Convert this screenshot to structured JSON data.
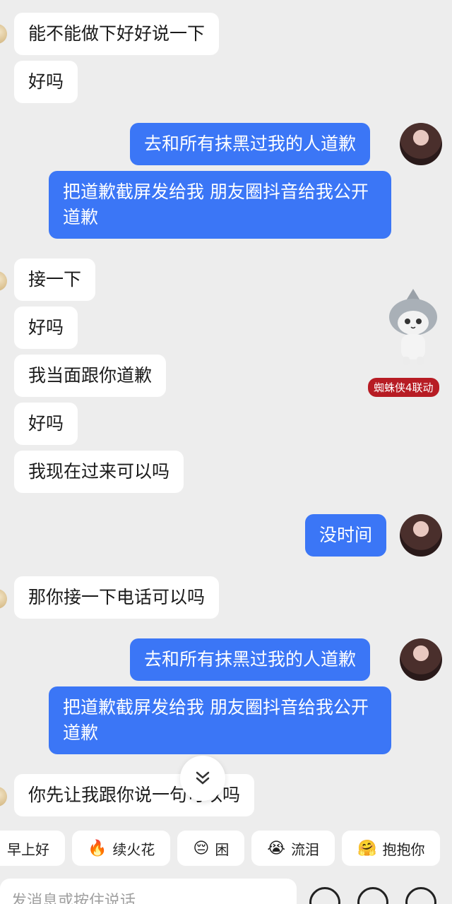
{
  "messages": [
    {
      "side": "left",
      "text": "能不能做下好好说一下"
    },
    {
      "side": "left",
      "text": "好吗"
    },
    {
      "side": "right",
      "text": "去和所有抹黑过我的人道歉"
    },
    {
      "side": "right",
      "text": "把道歉截屏发给我 朋友圈抖音给我公开道歉"
    },
    {
      "side": "left",
      "text": "接一下"
    },
    {
      "side": "left",
      "text": "好吗"
    },
    {
      "side": "left",
      "text": "我当面跟你道歉"
    },
    {
      "side": "left",
      "text": "好吗"
    },
    {
      "side": "left",
      "text": "我现在过来可以吗"
    },
    {
      "side": "right",
      "text": "没时间"
    },
    {
      "side": "left",
      "text": "那你接一下电话可以吗"
    },
    {
      "side": "right",
      "text": "去和所有抹黑过我的人道歉"
    },
    {
      "side": "right",
      "text": "把道歉截屏发给我 朋友圈抖音给我公开道歉"
    },
    {
      "side": "left",
      "text": "你先让我跟你说一句可以吗"
    }
  ],
  "sticker": {
    "badge": "蜘蛛侠4联动",
    "icon": "shark-hat-cat-sticker"
  },
  "scroll_button": {
    "icon": "double-chevron-down-icon"
  },
  "quick_replies": [
    {
      "emoji": "",
      "label": "早上好"
    },
    {
      "emoji": "🔥",
      "label": "续火花"
    },
    {
      "emoji": "😔",
      "label": "困"
    },
    {
      "emoji": "😭",
      "label": "流泪"
    },
    {
      "emoji": "🤗",
      "label": "抱抱你"
    }
  ],
  "input": {
    "placeholder": "发消息或按住说话"
  },
  "colors": {
    "bubble_right": "#3b76f6",
    "bubble_left": "#ffffff",
    "background": "#ededed",
    "badge": "#b71c24"
  }
}
